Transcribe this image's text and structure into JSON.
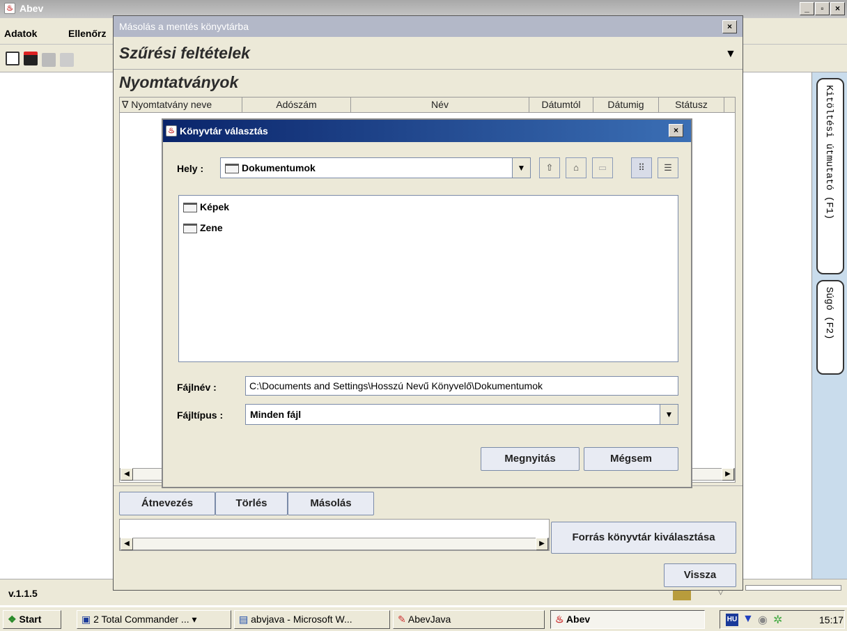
{
  "main": {
    "title": "Abev",
    "menu": [
      "Adatok",
      "Ellenőrz"
    ],
    "version": "v.1.1.5",
    "right_tabs": [
      "Kitöltési útmutató (F1)",
      "Súgó (F2)"
    ]
  },
  "copy_window": {
    "title": "Másolás a mentés könyvtárba",
    "filter_heading": "Szűrési feltételek",
    "forms_heading": "Nyomtatványok",
    "columns": [
      "∇ Nyomtatvány neve",
      "Adószám",
      "Név",
      "Dátumtól",
      "Dátumig",
      "Státusz"
    ],
    "buttons": {
      "rename": "Átnevezés",
      "delete": "Törlés",
      "copy": "Másolás",
      "select_source": "Forrás könyvtár kiválasztása",
      "back": "Vissza"
    }
  },
  "dir_dialog": {
    "title": "Könyvtár választás",
    "location_label": "Hely :",
    "location_value": "Dokumentumok",
    "files": [
      "Képek",
      "Zene"
    ],
    "filename_label": "Fájlnév :",
    "filename_value": "C:\\Documents and Settings\\Hosszú Nevű Könyvelő\\Dokumentumok",
    "filetype_label": "Fájltípus :",
    "filetype_value": "Minden fájl",
    "open_button": "Megnyitás",
    "cancel_button": "Mégsem"
  },
  "taskbar": {
    "start": "Start",
    "items": [
      "2 Total Commander ...",
      "abvjava - Microsoft W...",
      "AbevJava",
      "Abev"
    ],
    "tray_lang": "HU",
    "clock": "15:17"
  }
}
